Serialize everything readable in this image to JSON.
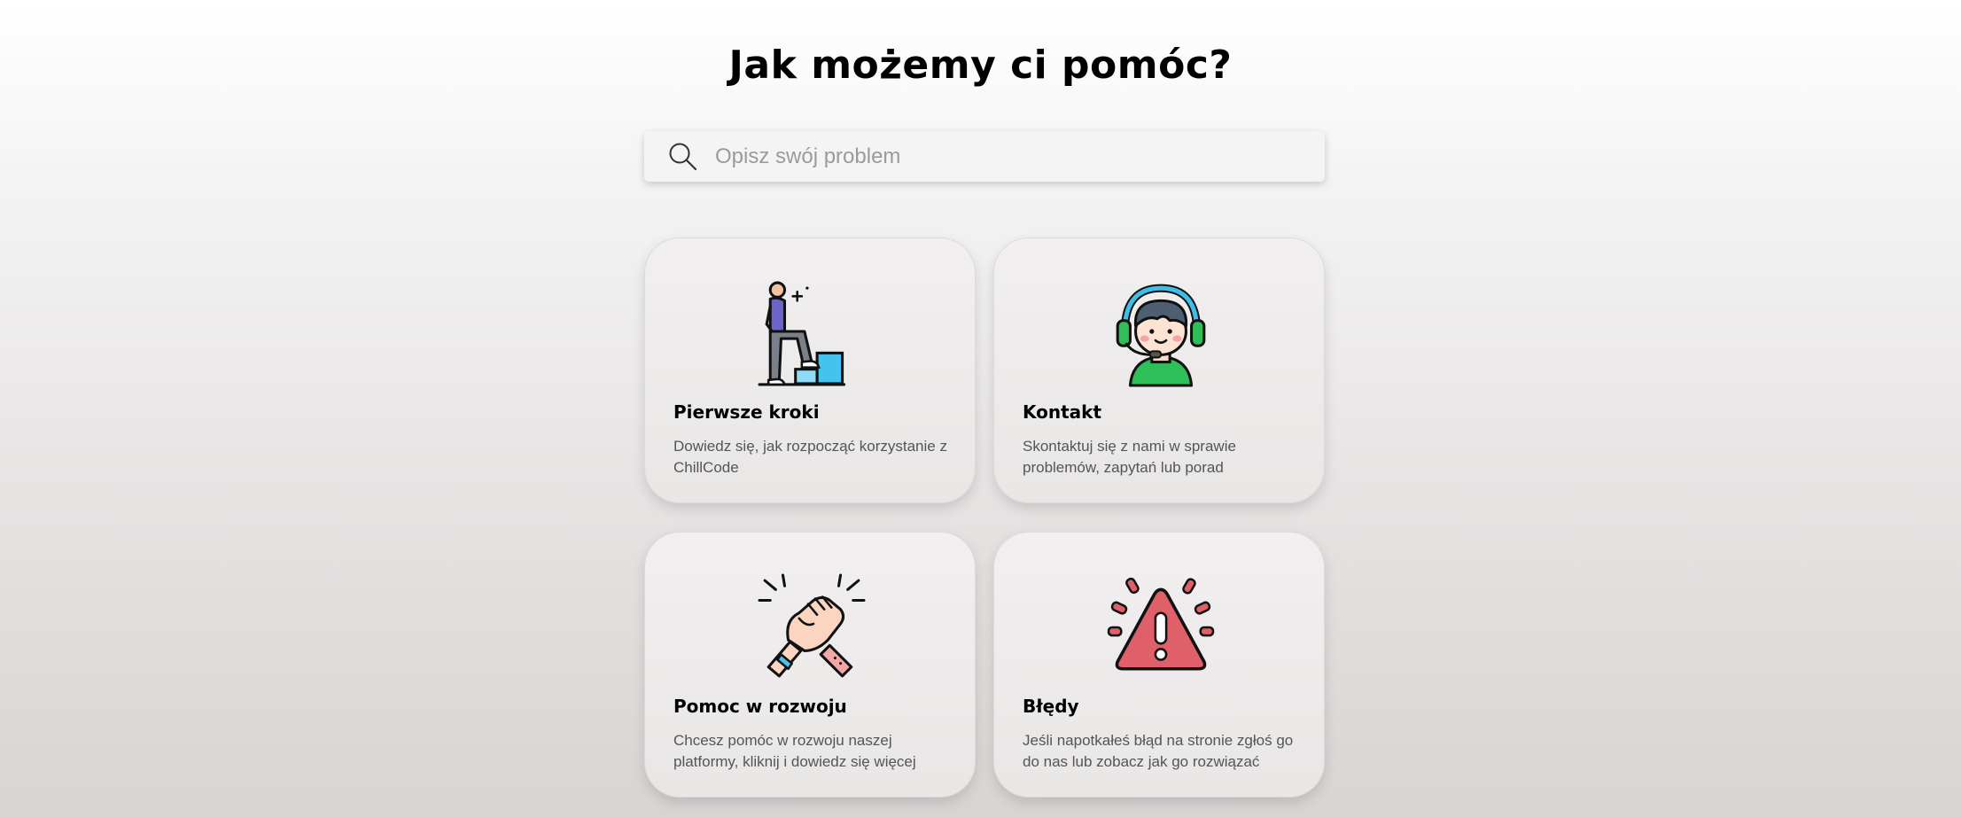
{
  "header": {
    "title": "Jak możemy ci pomóc?"
  },
  "search": {
    "placeholder": "Opisz swój problem",
    "value": "",
    "icon": "search-icon"
  },
  "cards": [
    {
      "title": "Pierwsze kroki",
      "description": "Dowiedz się, jak rozpocząć korzystanie z ChillCode",
      "icon": "climbing-steps-person-icon"
    },
    {
      "title": "Kontakt",
      "description": "Skontaktuj się z nami w sprawie problemów, zapytań lub porad",
      "icon": "support-agent-headset-icon"
    },
    {
      "title": "Pomoc w rozwoju",
      "description": "Chcesz pomóc w rozwoju naszej platformy, kliknij i dowiedz się więcej",
      "icon": "handshake-icon"
    },
    {
      "title": "Błędy",
      "description": "Jeśli napotkałeś błąd na stronie zgłoś go do nas lub zobacz jak go rozwiązać",
      "icon": "warning-triangle-icon"
    }
  ],
  "colors": {
    "text": "#000000",
    "muted_text": "#555555",
    "placeholder": "#9b9a9e",
    "card_bg": "#eeebeb",
    "accent_blue": "#3cc0e8",
    "accent_green": "#2fbf59",
    "accent_red": "#e0606a"
  }
}
